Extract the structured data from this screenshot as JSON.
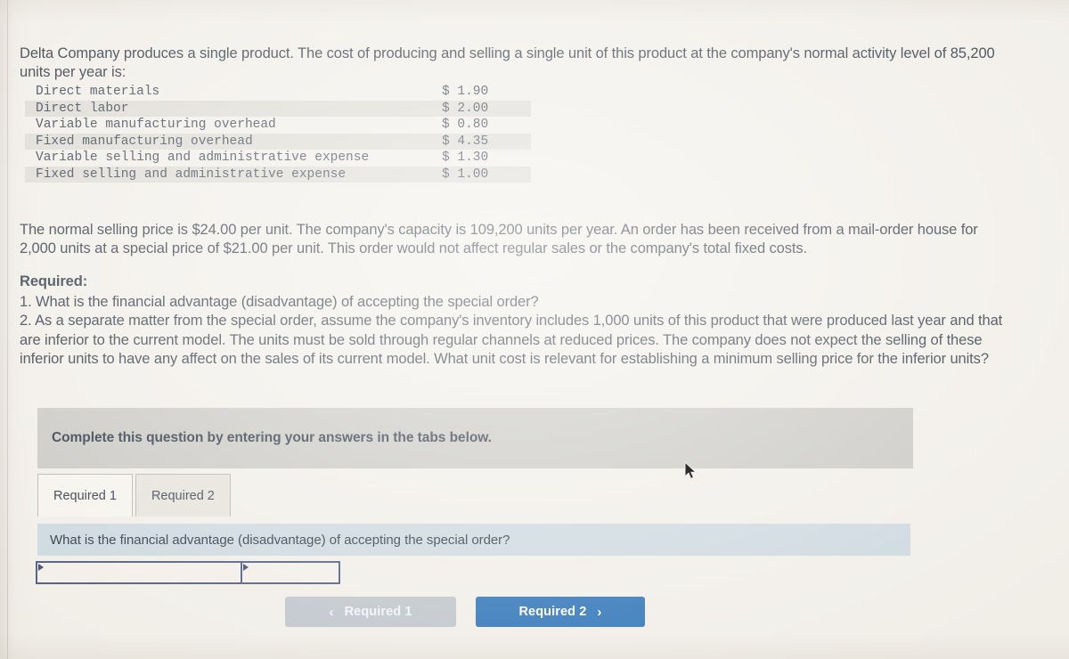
{
  "intro": {
    "paragraph": "Delta Company produces a single product. The cost of producing and selling a single unit of this product at the company's normal activity level of 85,200 units per year is:"
  },
  "cost_table": {
    "rows": [
      {
        "label": "Direct materials",
        "amount": "$ 1.90"
      },
      {
        "label": "Direct labor",
        "amount": "$ 2.00"
      },
      {
        "label": "Variable manufacturing overhead",
        "amount": "$ 0.80"
      },
      {
        "label": "Fixed manufacturing overhead",
        "amount": "$ 4.35"
      },
      {
        "label": "Variable selling and administrative expense",
        "amount": "$ 1.30"
      },
      {
        "label": "Fixed selling and administrative expense",
        "amount": "$ 1.00"
      }
    ]
  },
  "details": {
    "paragraph": "The normal selling price is $24.00 per unit. The company's capacity is 109,200 units per year. An order has been received from a mail-order house for 2,000 units at a special price of $21.00 per unit. This order would not affect regular sales or the company's total fixed costs."
  },
  "required": {
    "heading": "Required:",
    "item_1": "1. What is the financial advantage (disadvantage) of accepting the special order?",
    "item_2": "2. As a separate matter from the special order, assume the company's inventory includes 1,000 units of this product that were produced last year and that are inferior to the current model. The units must be sold through regular channels at reduced prices. The company does not expect the selling of these inferior units to have any affect on the sales of its current model. What unit cost is relevant for establishing a minimum selling price for the inferior units?"
  },
  "instruction_banner": {
    "text": "Complete this question by entering your answers in the tabs below."
  },
  "tabs": [
    {
      "label": "Required 1",
      "active": true
    },
    {
      "label": "Required 2",
      "active": false
    }
  ],
  "question_bar": {
    "text": "What is the financial advantage (disadvantage) of accepting the special order?"
  },
  "answer_inputs": [
    {
      "value": "",
      "placeholder": ""
    },
    {
      "value": "",
      "placeholder": ""
    }
  ],
  "nav_buttons": {
    "prev": {
      "label": "Required 1",
      "chevron": "‹",
      "disabled": true
    },
    "next": {
      "label": "Required 2",
      "chevron": "›",
      "disabled": false
    }
  },
  "colors": {
    "page_background": "#f1eee8",
    "banner_gray": "#c9c8c3",
    "question_bar_blue": "#ccd8df",
    "primary_blue": "#2f74b7",
    "disabled_gray": "#c0c5cb",
    "input_border": "#4d5a82",
    "text": "#2f3744"
  }
}
